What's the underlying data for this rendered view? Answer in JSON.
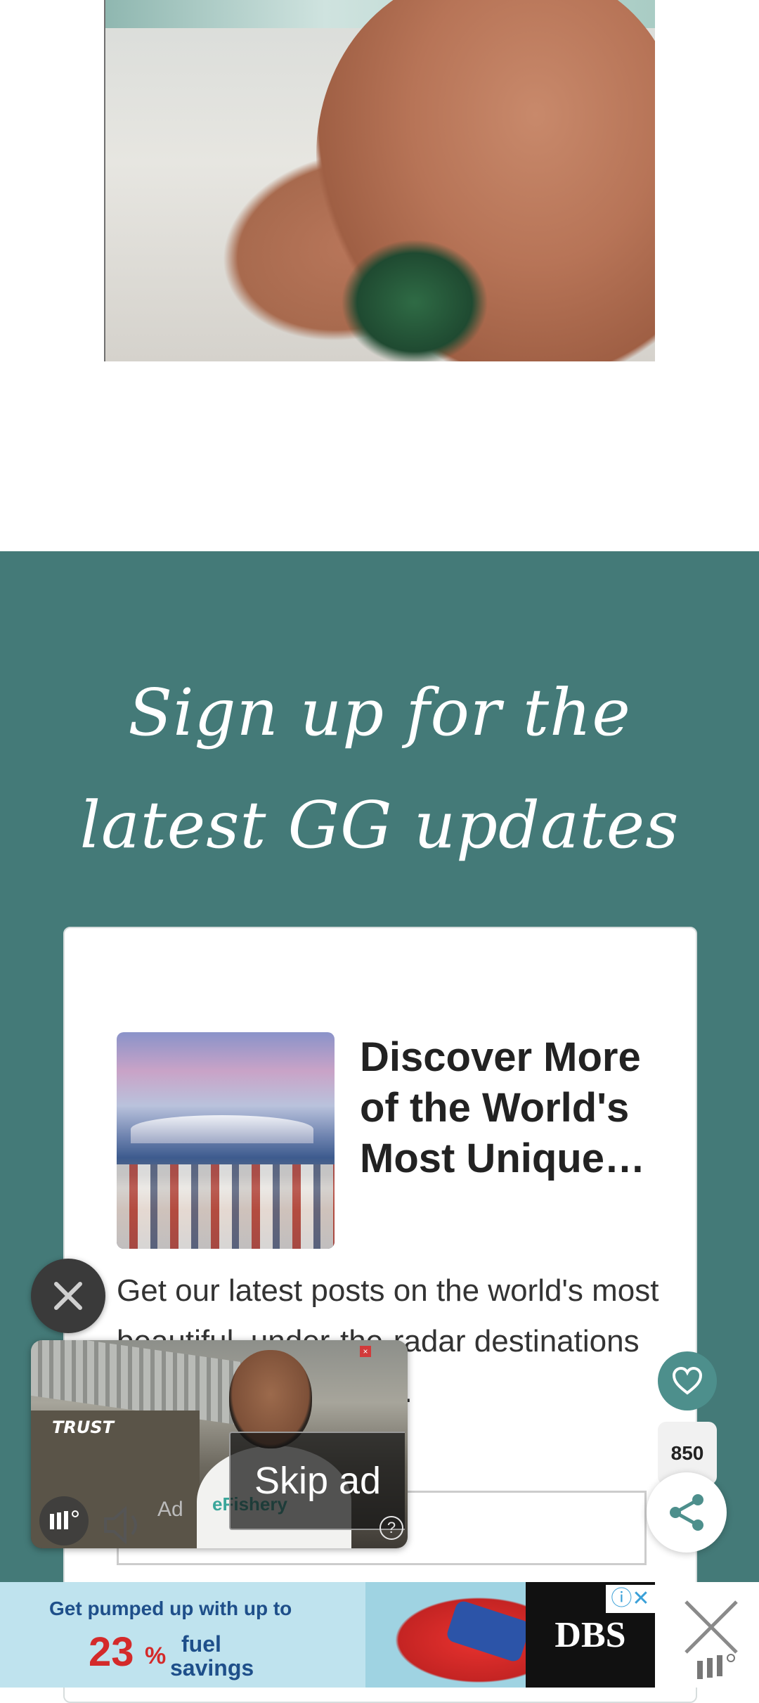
{
  "signup": {
    "title": "Sign up for the latest GG updates",
    "card": {
      "heading": "Discover More of the World's Most Unique…",
      "body": "Get our latest posts on the world's most beautiful, under-the-radar destinations straight to your inbox."
    }
  },
  "video_ad": {
    "skip_label": "Skip ad",
    "ad_label": "Ad",
    "help_symbol": "?",
    "image_text": "TRUST",
    "shirt_text": "eFishery"
  },
  "social": {
    "share_count": "850"
  },
  "banner_ad": {
    "line1": "Get pumped up with up to",
    "percent": "23",
    "percent_sign": "%",
    "word1": "fuel",
    "word2": "savings",
    "brand": "DBS"
  },
  "icons": {
    "close": "close-icon",
    "heart": "heart-icon",
    "share": "share-icon",
    "speaker": "speaker-icon"
  },
  "colors": {
    "signup_bg": "#447a78",
    "heart_bg": "#4d8f8c",
    "banner_bg": "#bfe3ee",
    "accent_red": "#d42a2a"
  }
}
